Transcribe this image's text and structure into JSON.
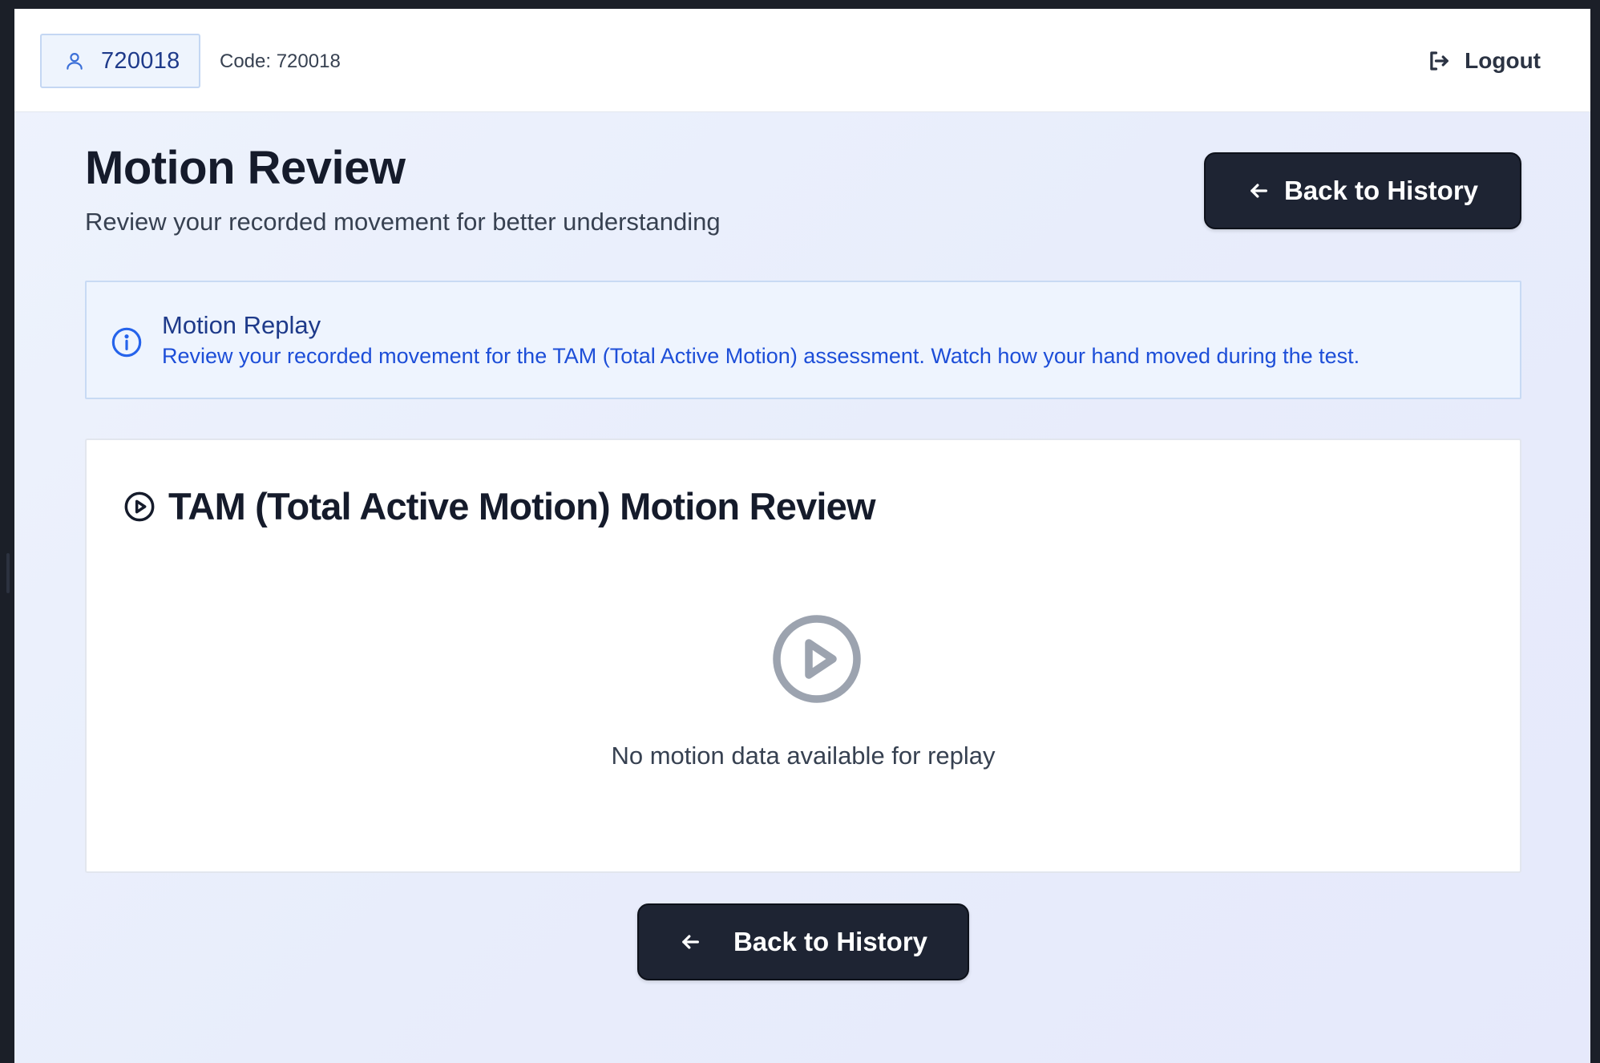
{
  "header": {
    "user_id": "720018",
    "code_text": "Code: 720018",
    "logout_label": "Logout"
  },
  "page": {
    "title": "Motion Review",
    "subtitle": "Review your recorded movement for better understanding",
    "back_button_label": "Back to History"
  },
  "info": {
    "title": "Motion Replay",
    "body": "Review your recorded movement for the TAM (Total Active Motion) assessment. Watch how your hand moved during the test."
  },
  "card": {
    "title": "TAM (Total Active Motion) Motion Review",
    "empty_message": "No motion data available for replay"
  },
  "footer": {
    "back_button_label": "Back to History"
  },
  "icons": {
    "user": "user-icon",
    "logout": "logout-icon",
    "back": "arrow-left-icon",
    "info": "info-icon",
    "play": "play-circle-icon"
  },
  "colors": {
    "primary_dark": "#1e2433",
    "info_blue": "#1d4ed8",
    "info_bg": "#eef4fe"
  }
}
